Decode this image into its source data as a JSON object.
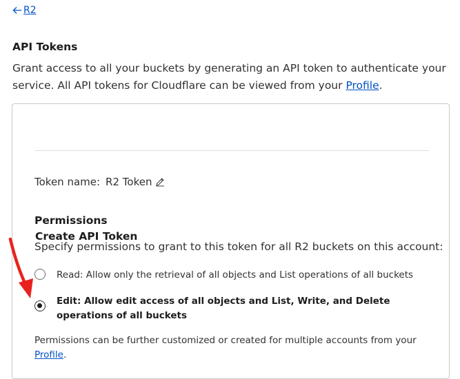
{
  "nav": {
    "back_label": "R2"
  },
  "api_tokens": {
    "title": "API Tokens",
    "description_part1": "Grant access to all your buckets by generating an API token to authenticate your service. All API tokens for Cloudflare can be viewed from your ",
    "profile_link": "Profile",
    "description_end": "."
  },
  "create_token": {
    "title": "Create API Token",
    "token_name_label": "Token name:",
    "token_name_value": "R2 Token",
    "edit_icon": "pencil-icon",
    "permissions": {
      "title": "Permissions",
      "description": "Specify permissions to grant to this token for all R2 buckets on this account:",
      "options": [
        {
          "label": "Read: Allow only the retrieval of all objects and List operations of all buckets",
          "selected": false
        },
        {
          "label": "Edit: Allow edit access of all objects and List, Write, and Delete operations of all buckets",
          "selected": true
        }
      ],
      "footnote_part1": "Permissions can be further customized or created for multiple accounts from your ",
      "footnote_link": "Profile",
      "footnote_end": "."
    }
  },
  "colors": {
    "link": "#0051c3",
    "annotation_arrow": "#e8231f"
  }
}
